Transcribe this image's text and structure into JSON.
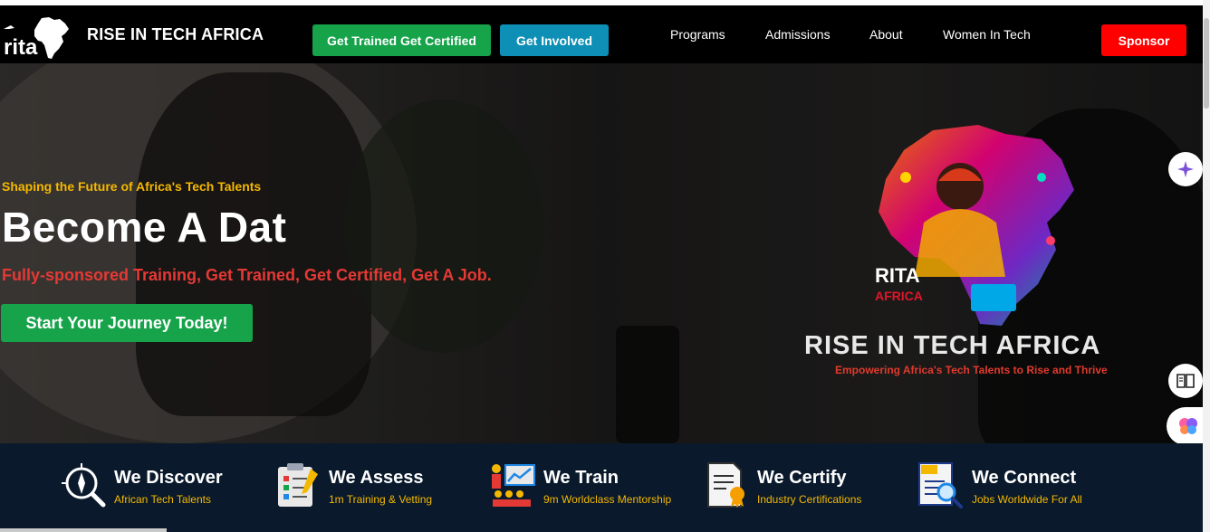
{
  "brand": {
    "name": "RISE IN TECH AFRICA",
    "logo_text": "rita"
  },
  "nav": {
    "cta_trained": "Get Trained Get Certified",
    "cta_involved": "Get Involved",
    "links": [
      "Programs",
      "Admissions",
      "About",
      "Women In Tech"
    ],
    "sponsor": "Sponsor"
  },
  "hero": {
    "eyebrow": "Shaping the Future of Africa's Tech Talents",
    "headline": "Become A Dat",
    "subline": "Fully-sponsored Training, Get Trained, Get Certified, Get A Job.",
    "cta": "Start Your Journey Today!",
    "art_badge_1": "RITA",
    "art_badge_2": "AFRICA",
    "art_title": "RISE IN TECH AFRICA",
    "art_subtitle": "Empowering Africa's Tech Talents to Rise and Thrive"
  },
  "features": [
    {
      "title": "We Discover",
      "sub": "African Tech Talents",
      "icon": "compass-search-icon"
    },
    {
      "title": "We Assess",
      "sub": "1m Training & Vetting",
      "icon": "clipboard-checklist-icon"
    },
    {
      "title": "We Train",
      "sub": "9m Worldclass Mentorship",
      "icon": "presentation-board-icon"
    },
    {
      "title": "We Certify",
      "sub": "Industry Certifications",
      "icon": "certificate-icon"
    },
    {
      "title": "We Connect",
      "sub": "Jobs Worldwide For All",
      "icon": "job-search-icon"
    }
  ],
  "colors": {
    "accent_green": "#16a34a",
    "accent_blue": "#0e8fb5",
    "accent_red": "#ff0000",
    "eyebrow_yellow": "#f5b800",
    "features_bg": "#0a1a2c"
  },
  "floating": [
    "sparkle-icon",
    "book-icon",
    "brain-icon"
  ]
}
